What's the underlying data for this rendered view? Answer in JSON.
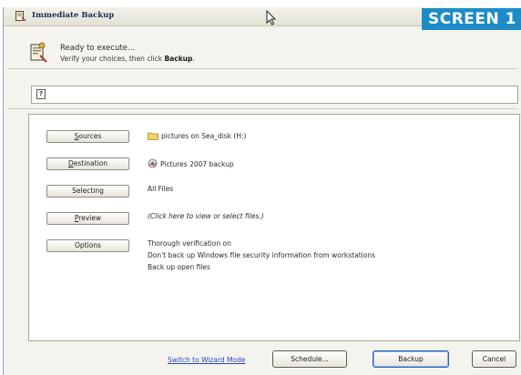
{
  "window": {
    "title": "Immediate Backup",
    "screen_label": "SCREEN 1"
  },
  "header": {
    "title": "Ready to execute...",
    "subtitle_prefix": "Verify your choices, then click ",
    "subtitle_bold": "Backup",
    "subtitle_suffix": "."
  },
  "info_bar": {
    "icon": "help-icon",
    "icon_glyph": "?"
  },
  "options": [
    {
      "label": "Sources",
      "value": "pictures on Sea_disk (H:)",
      "icon": "folder-icon"
    },
    {
      "label": "Destination",
      "value": "Pictures 2007 backup",
      "icon": "backup-set-icon"
    },
    {
      "label": "Selecting",
      "value": "All Files"
    },
    {
      "label": "Preview",
      "value": "(Click here to view or select files.)"
    },
    {
      "label": "Options",
      "value_lines": [
        "Thorough verification on",
        "Don't back up Windows file security information from workstations",
        "Back up open files"
      ]
    }
  ],
  "footer": {
    "wizard_link": "Switch to Wizard Mode",
    "schedule_button": "Schedule...",
    "backup_button": "Backup",
    "cancel_button": "Cancel"
  }
}
